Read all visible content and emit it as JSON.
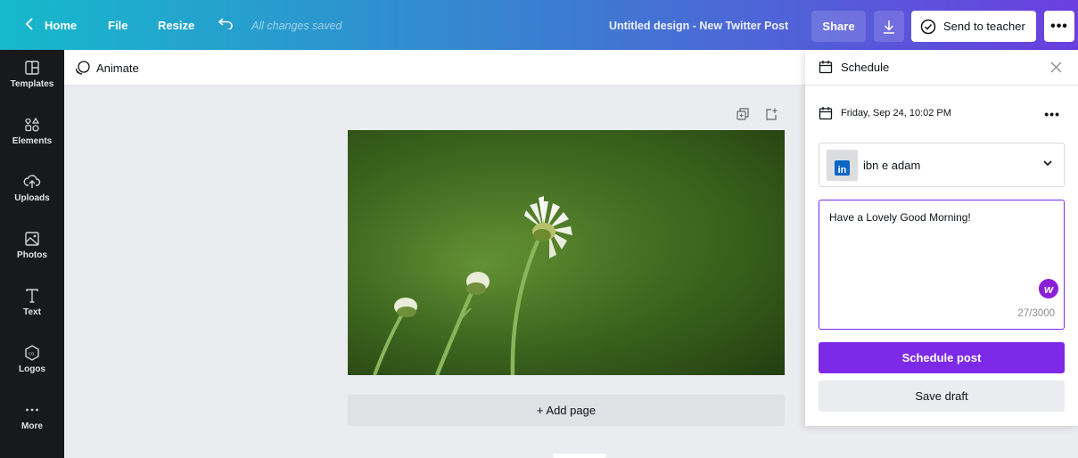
{
  "topbar": {
    "home_label": "Home",
    "file_label": "File",
    "resize_label": "Resize",
    "saved_status": "All changes saved",
    "design_title": "Untitled design - New Twitter Post",
    "share_label": "Share",
    "send_to_teacher_label": "Send to teacher",
    "more_label": "•••"
  },
  "sidebar": {
    "items": [
      {
        "label": "Templates",
        "icon": "templates-icon"
      },
      {
        "label": "Elements",
        "icon": "elements-icon"
      },
      {
        "label": "Uploads",
        "icon": "uploads-icon"
      },
      {
        "label": "Photos",
        "icon": "photos-icon"
      },
      {
        "label": "Text",
        "icon": "text-icon"
      },
      {
        "label": "Logos",
        "icon": "logos-icon"
      },
      {
        "label": "More",
        "icon": "more-icon"
      }
    ]
  },
  "toolbar": {
    "animate_label": "Animate"
  },
  "canvas": {
    "add_page_label": "+ Add page"
  },
  "schedule_panel": {
    "title": "Schedule",
    "datetime": "Friday, Sep 24, 10:02 PM",
    "account_name": "ibn e adam",
    "account_network": "in",
    "message": "Have a Lovely Good Morning!",
    "char_counter": "27/3000",
    "schedule_button": "Schedule post",
    "draft_button": "Save draft"
  },
  "colors": {
    "accent_purple": "#7d2ae8",
    "sidebar_bg": "#18191b",
    "linkedin_blue": "#0a66c2"
  }
}
